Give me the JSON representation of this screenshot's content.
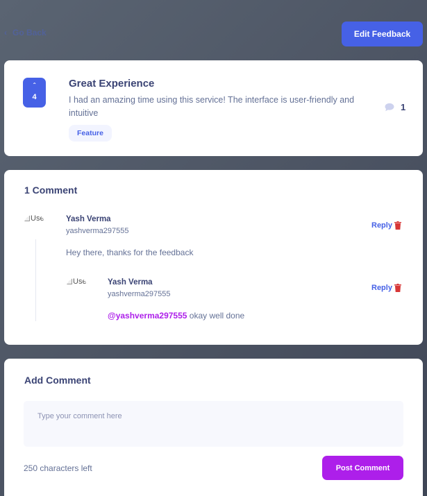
{
  "header": {
    "back_label": "Go Back",
    "edit_label": "Edit Feedback"
  },
  "feedback": {
    "upvotes": "4",
    "title": "Great Experience",
    "description": "I had an amazing time using this service! The interface is user-friendly and intuitive",
    "category": "Feature",
    "comment_count": "1"
  },
  "comments_section": {
    "title": "1 Comment",
    "comments": [
      {
        "avatar_alt": "User picture",
        "name": "Yash Verma",
        "username": "yashverma297555",
        "reply_label": "Reply",
        "text": "Hey there, thanks for the feedback",
        "replies": [
          {
            "avatar_alt": "User picture",
            "name": "Yash Verma",
            "username": "yashverma297555",
            "reply_label": "Reply",
            "mention": "@yashverma297555",
            "text": " okay well done"
          }
        ]
      }
    ]
  },
  "add_comment": {
    "title": "Add Comment",
    "placeholder": "Type your comment here",
    "chars_left": "250 characters left",
    "post_label": "Post Comment"
  },
  "colors": {
    "primary": "#4661e6",
    "accent": "#ad1fea",
    "danger": "#d73737",
    "text": "#3a4374",
    "muted": "#647196"
  },
  "icons": {
    "back": "chevron-left-icon",
    "upvote": "chevron-up-icon",
    "comments": "comment-bubble-icon",
    "delete": "trash-icon"
  }
}
